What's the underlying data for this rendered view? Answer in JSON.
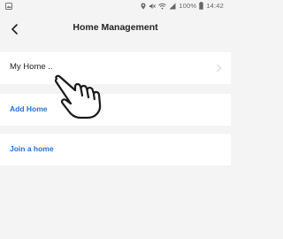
{
  "status_bar": {
    "battery_percent": "100%",
    "time": "14:42",
    "icons": [
      "gallery-icon",
      "location-icon",
      "mute-icon",
      "wifi-icon",
      "signal-icon",
      "battery-icon"
    ]
  },
  "header": {
    "title": "Home Management",
    "back_icon": "back-arrow-icon"
  },
  "homes": [
    {
      "label": "My Home .."
    }
  ],
  "actions": {
    "add_home": "Add Home",
    "join_home": "Join a home"
  },
  "colors": {
    "background": "#f4f4f4",
    "link": "#1e73d8",
    "text": "#222222"
  }
}
